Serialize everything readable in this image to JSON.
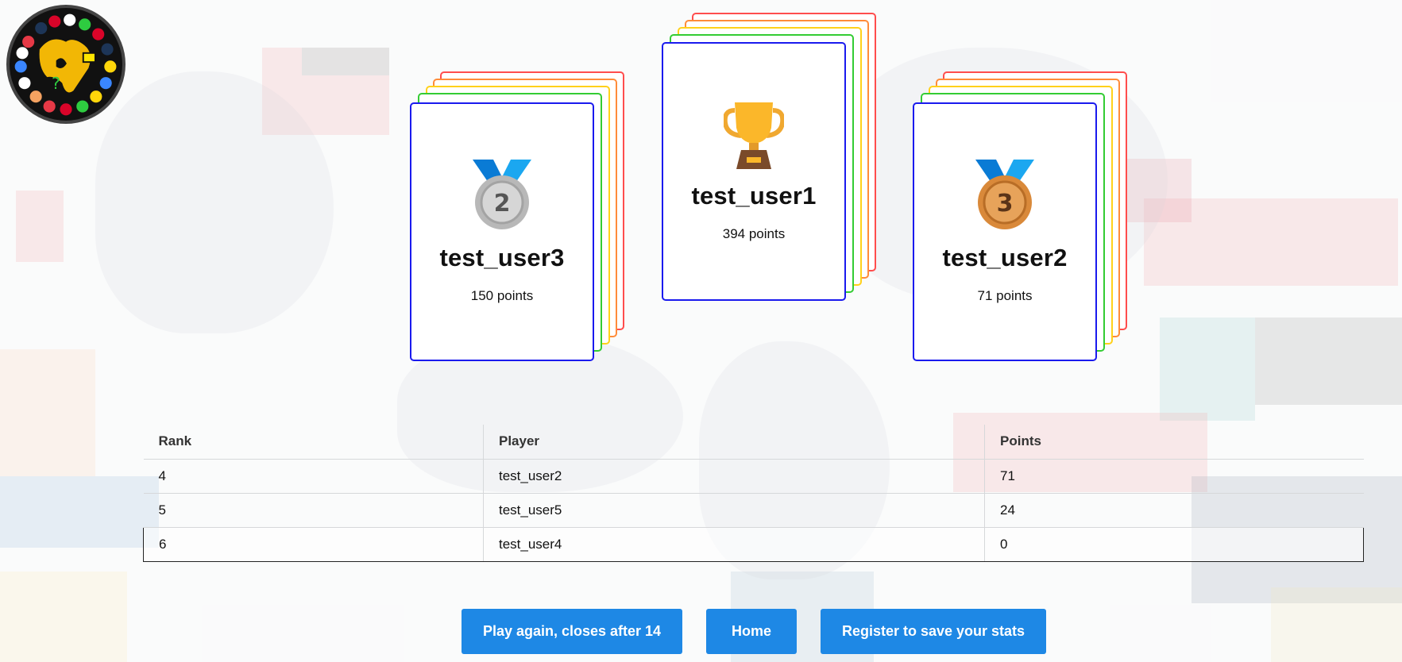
{
  "podium": [
    {
      "place": "second",
      "icon": "silver-medal-icon",
      "name": "test_user3",
      "points": "150 points"
    },
    {
      "place": "first",
      "icon": "trophy-icon",
      "name": "test_user1",
      "points": "394 points"
    },
    {
      "place": "third",
      "icon": "bronze-medal-icon",
      "name": "test_user2",
      "points": "71 points"
    }
  ],
  "table": {
    "headers": [
      "Rank",
      "Player",
      "Points"
    ],
    "rows": [
      [
        "4",
        "test_user2",
        "71"
      ],
      [
        "5",
        "test_user5",
        "24"
      ],
      [
        "6",
        "test_user4",
        "0"
      ]
    ]
  },
  "buttons": {
    "play_again": "Play again, closes after 14",
    "home": "Home",
    "register": "Register to save your stats"
  },
  "colors": {
    "card_border": "#1a1aee",
    "stack_layers": [
      "#ff4d4d",
      "#ff8c3a",
      "#ffd11a",
      "#33cc33"
    ],
    "button": "#1e88e5"
  }
}
